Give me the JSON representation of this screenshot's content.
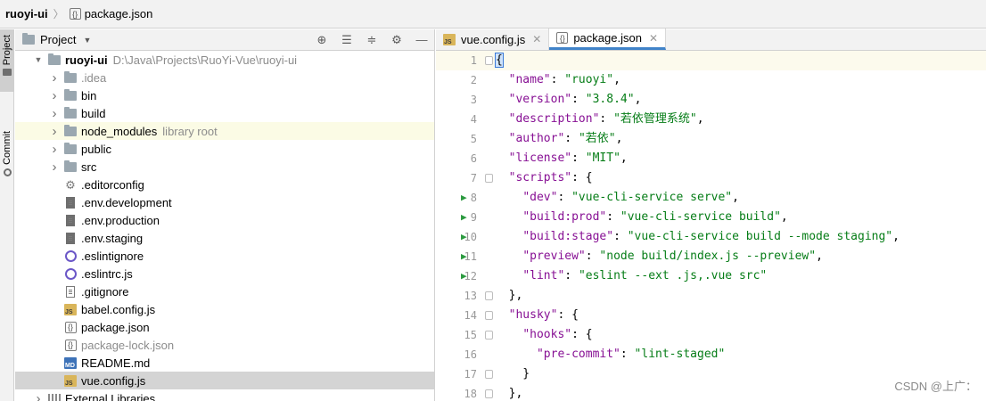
{
  "breadcrumb": {
    "root": "ruoyi-ui",
    "file": "package.json"
  },
  "toolstrip": {
    "project_tab": "Project",
    "commit_tab": "Commit"
  },
  "project_panel": {
    "title": "Project",
    "root": {
      "name": "ruoyi-ui",
      "path": "D:\\Java\\Projects\\RuoYi-Vue\\ruoyi-ui"
    },
    "items": [
      {
        "label": ".idea",
        "icon": "folder-icon",
        "expandable": true,
        "muted": true,
        "hint": ""
      },
      {
        "label": "bin",
        "icon": "folder-icon",
        "expandable": true,
        "muted": false,
        "hint": ""
      },
      {
        "label": "build",
        "icon": "folder-icon",
        "expandable": true,
        "muted": false,
        "hint": ""
      },
      {
        "label": "node_modules",
        "icon": "folder-icon",
        "expandable": true,
        "muted": false,
        "hint": "library root"
      },
      {
        "label": "public",
        "icon": "folder-icon",
        "expandable": true,
        "muted": false,
        "hint": ""
      },
      {
        "label": "src",
        "icon": "folder-icon",
        "expandable": true,
        "muted": false,
        "hint": ""
      },
      {
        "label": ".editorconfig",
        "icon": "gear-icon",
        "expandable": false,
        "muted": false,
        "hint": ""
      },
      {
        "label": ".env.development",
        "icon": "env-file-icon",
        "expandable": false,
        "muted": false,
        "hint": ""
      },
      {
        "label": ".env.production",
        "icon": "env-file-icon",
        "expandable": false,
        "muted": false,
        "hint": ""
      },
      {
        "label": ".env.staging",
        "icon": "env-file-icon",
        "expandable": false,
        "muted": false,
        "hint": ""
      },
      {
        "label": ".eslintignore",
        "icon": "eslint-icon",
        "expandable": false,
        "muted": false,
        "hint": ""
      },
      {
        "label": ".eslintrc.js",
        "icon": "eslint-icon",
        "expandable": false,
        "muted": false,
        "hint": ""
      },
      {
        "label": ".gitignore",
        "icon": "text-file-icon",
        "expandable": false,
        "muted": false,
        "hint": ""
      },
      {
        "label": "babel.config.js",
        "icon": "js-file-icon",
        "expandable": false,
        "muted": false,
        "hint": ""
      },
      {
        "label": "package.json",
        "icon": "json-file-icon",
        "expandable": false,
        "muted": false,
        "hint": ""
      },
      {
        "label": "package-lock.json",
        "icon": "json-file-icon",
        "expandable": false,
        "muted": true,
        "hint": ""
      },
      {
        "label": "README.md",
        "icon": "md-file-icon",
        "expandable": false,
        "muted": false,
        "hint": ""
      },
      {
        "label": "vue.config.js",
        "icon": "js-file-icon",
        "expandable": false,
        "muted": false,
        "hint": "",
        "selected": true
      }
    ],
    "external_libraries": "External Libraries"
  },
  "editor": {
    "tabs": [
      {
        "label": "vue.config.js",
        "icon": "js-file-icon",
        "active": false
      },
      {
        "label": "package.json",
        "icon": "json-file-icon",
        "active": true
      }
    ],
    "line_numbers": [
      "1",
      "2",
      "3",
      "4",
      "5",
      "6",
      "7",
      "8",
      "9",
      "10",
      "11",
      "12",
      "13",
      "14",
      "15",
      "16",
      "17",
      "18"
    ],
    "run_lines": [
      "8",
      "9",
      "10",
      "11",
      "12"
    ],
    "code": [
      "{",
      "  \"name\": \"ruoyi\",",
      "  \"version\": \"3.8.4\",",
      "  \"description\": \"若依管理系统\",",
      "  \"author\": \"若依\",",
      "  \"license\": \"MIT\",",
      "  \"scripts\": {",
      "    \"dev\": \"vue-cli-service serve\",",
      "    \"build:prod\": \"vue-cli-service build\",",
      "    \"build:stage\": \"vue-cli-service build --mode staging\",",
      "    \"preview\": \"node build/index.js --preview\",",
      "    \"lint\": \"eslint --ext .js,.vue src\"",
      "  },",
      "  \"husky\": {",
      "    \"hooks\": {",
      "      \"pre-commit\": \"lint-staged\"",
      "    }",
      "  },"
    ]
  },
  "watermark": "CSDN @上广：",
  "colors": {
    "key": "#871094",
    "string": "#067d17",
    "run_arrow": "#2b9a3f",
    "selection": "#d4d4d4",
    "highlight_row": "#fbfbe5",
    "active_tab_underline": "#4083c9"
  }
}
